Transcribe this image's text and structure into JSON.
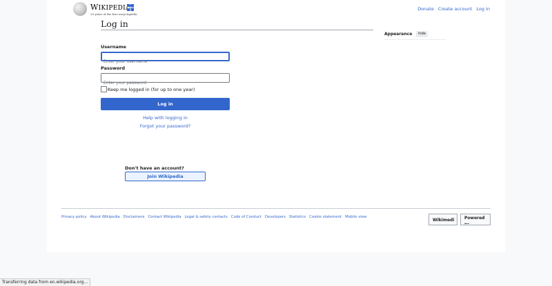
{
  "header": {
    "logo_wordmark": "Wikipedia",
    "logo_tagline": "25 years of the free encyclopedia",
    "links": [
      "Donate",
      "Create account",
      "Log in"
    ]
  },
  "page": {
    "title": "Log in"
  },
  "appearance": {
    "label": "Appearance",
    "hide_label": "hide"
  },
  "form": {
    "username_label": "Username",
    "username_placeholder": "Enter your username",
    "password_label": "Password",
    "password_placeholder": "Enter your password",
    "remember_label": "Keep me logged in (for up to one year)",
    "submit_label": "Log in",
    "help_link": "Help with logging in",
    "forgot_link": "Forgot your password?",
    "no_account_label": "Don't have an account?",
    "join_label": "Join Wikipedia"
  },
  "footer": {
    "links": [
      "Privacy policy",
      "About Wikipedia",
      "Disclaimers",
      "Contact Wikipedia",
      "Legal & safety contacts",
      "Code of Conduct",
      "Developers",
      "Statistics",
      "Cookie statement",
      "Mobile view"
    ],
    "badge_wikimedia": "Wikimedi",
    "badge_powered": "Powered"
  },
  "status_bar": {
    "text": "Transferring data from en.wikipedia.org..."
  },
  "colors": {
    "link": "#3366cc",
    "primary_button": "#3366cc",
    "border": "#a2a9b1"
  }
}
